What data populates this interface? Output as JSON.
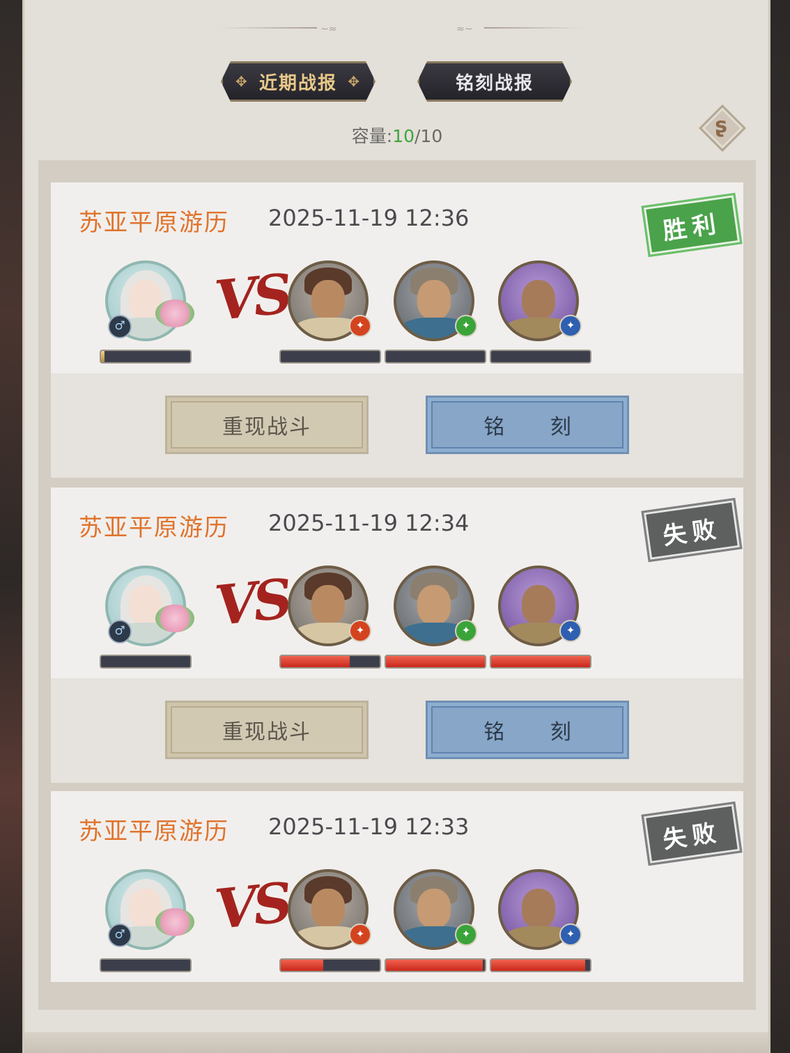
{
  "tabs": [
    {
      "label": "近期战报",
      "active": true
    },
    {
      "label": "铭刻战报",
      "active": false
    }
  ],
  "capacity": {
    "label": "容量:",
    "current": "10",
    "max": "/10"
  },
  "buttons": {
    "replay": "重现战斗",
    "inscribe": "铭 刻"
  },
  "vs_text": "VS",
  "icons": {
    "sync": "sync-icon",
    "gender": "male-icon"
  },
  "colors": {
    "title": "#e0732c",
    "win": "#4aa24a",
    "lose": "#5e5f5f",
    "capacity_current": "#3fa43f",
    "hp": "#c9281c"
  },
  "battles": [
    {
      "title": "苏亚平原游历",
      "time": "2025-11-19 12:36",
      "result": "胜利",
      "hero_hp": 0.04,
      "enemy_hp": [
        0,
        0,
        0
      ]
    },
    {
      "title": "苏亚平原游历",
      "time": "2025-11-19 12:34",
      "result": "失败",
      "hero_hp": 0,
      "enemy_hp": [
        0.7,
        1.0,
        1.0
      ]
    },
    {
      "title": "苏亚平原游历",
      "time": "2025-11-19 12:33",
      "result": "失败",
      "hero_hp": 0,
      "enemy_hp": [
        0.43,
        0.98,
        0.95
      ]
    }
  ]
}
